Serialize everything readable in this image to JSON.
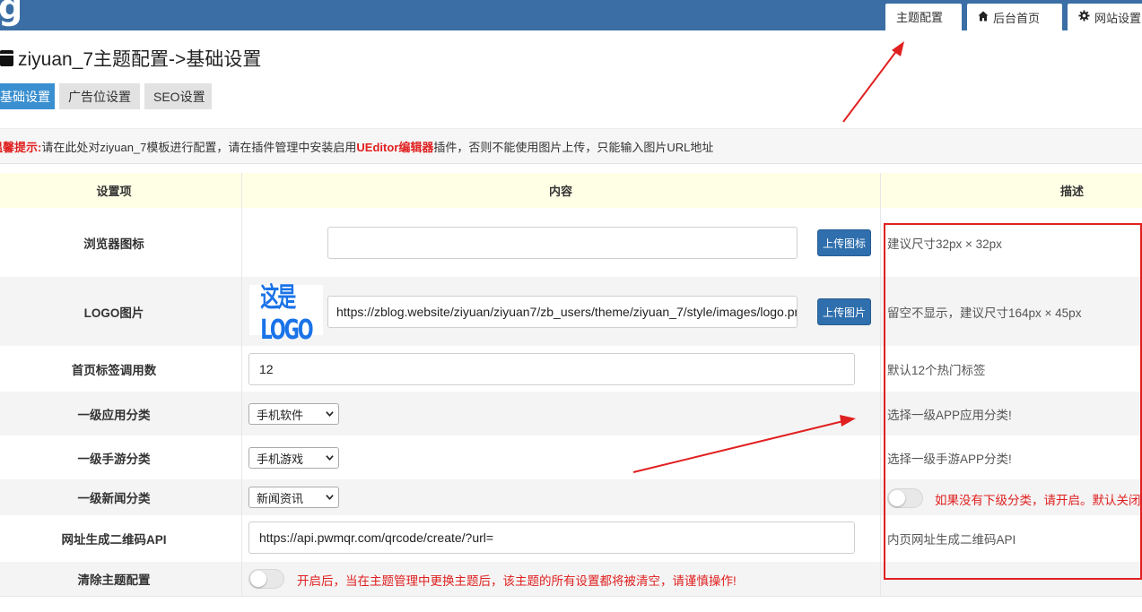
{
  "topbar": {
    "logo_fragment": "g",
    "tabs": [
      {
        "label": "主题配置",
        "icon": ""
      },
      {
        "label": "后台首页",
        "icon": "home-icon"
      },
      {
        "label": "网站设置",
        "icon": "gear-icon"
      }
    ]
  },
  "page": {
    "title": "ziyuan_7主题配置->基础设置",
    "subtabs": [
      "基础设置",
      "广告位设置",
      "SEO设置"
    ]
  },
  "tip": {
    "label": "温馨提示:",
    "text_before": "请在此处对ziyuan_7模板进行配置，请在插件管理中安装启用",
    "highlight": "UEditor编辑器",
    "text_after": "插件，否则不能使用图片上传，只能输入图片URL地址"
  },
  "table": {
    "headers": [
      "设置项",
      "内容",
      "描述"
    ],
    "rows": {
      "favicon": {
        "label": "浏览器图标",
        "value": "",
        "button": "上传图标",
        "desc": "建议尺寸32px × 32px"
      },
      "logo": {
        "label": "LOGO图片",
        "logo_text": "这是LOGO",
        "value": "https://zblog.website/ziyuan/ziyuan7/zb_users/theme/ziyuan_7/style/images/logo.png",
        "button": "上传图片",
        "desc": "留空不显示，建议尺寸164px × 45px"
      },
      "tag_count": {
        "label": "首页标签调用数",
        "value": "12",
        "desc": "默认12个热门标签"
      },
      "app_cat": {
        "label": "一级应用分类",
        "selected": "手机软件",
        "desc": "选择一级APP应用分类!"
      },
      "game_cat": {
        "label": "一级手游分类",
        "selected": "手机游戏",
        "desc": "选择一级手游APP分类!"
      },
      "news_cat": {
        "label": "一级新闻分类",
        "selected": "新闻资讯",
        "toggle_on": false,
        "desc": "如果没有下级分类，请开启。默认关闭"
      },
      "qrcode_api": {
        "label": "网址生成二维码API",
        "value": "https://api.pwmqr.com/qrcode/create/?url=",
        "desc": "内页网址生成二维码API"
      },
      "clear_config": {
        "label": "清除主题配置",
        "toggle_on": false,
        "warning": "开启后，当在主题管理中更换主题后，该主题的所有设置都将被清空，请谨慎操作!"
      }
    }
  },
  "colors": {
    "topbar": "#3a6ea5",
    "active_subtab": "#3a8fd0",
    "header_row": "#ffffe6",
    "button": "#2f6fad",
    "warning_red": "#e02020"
  }
}
